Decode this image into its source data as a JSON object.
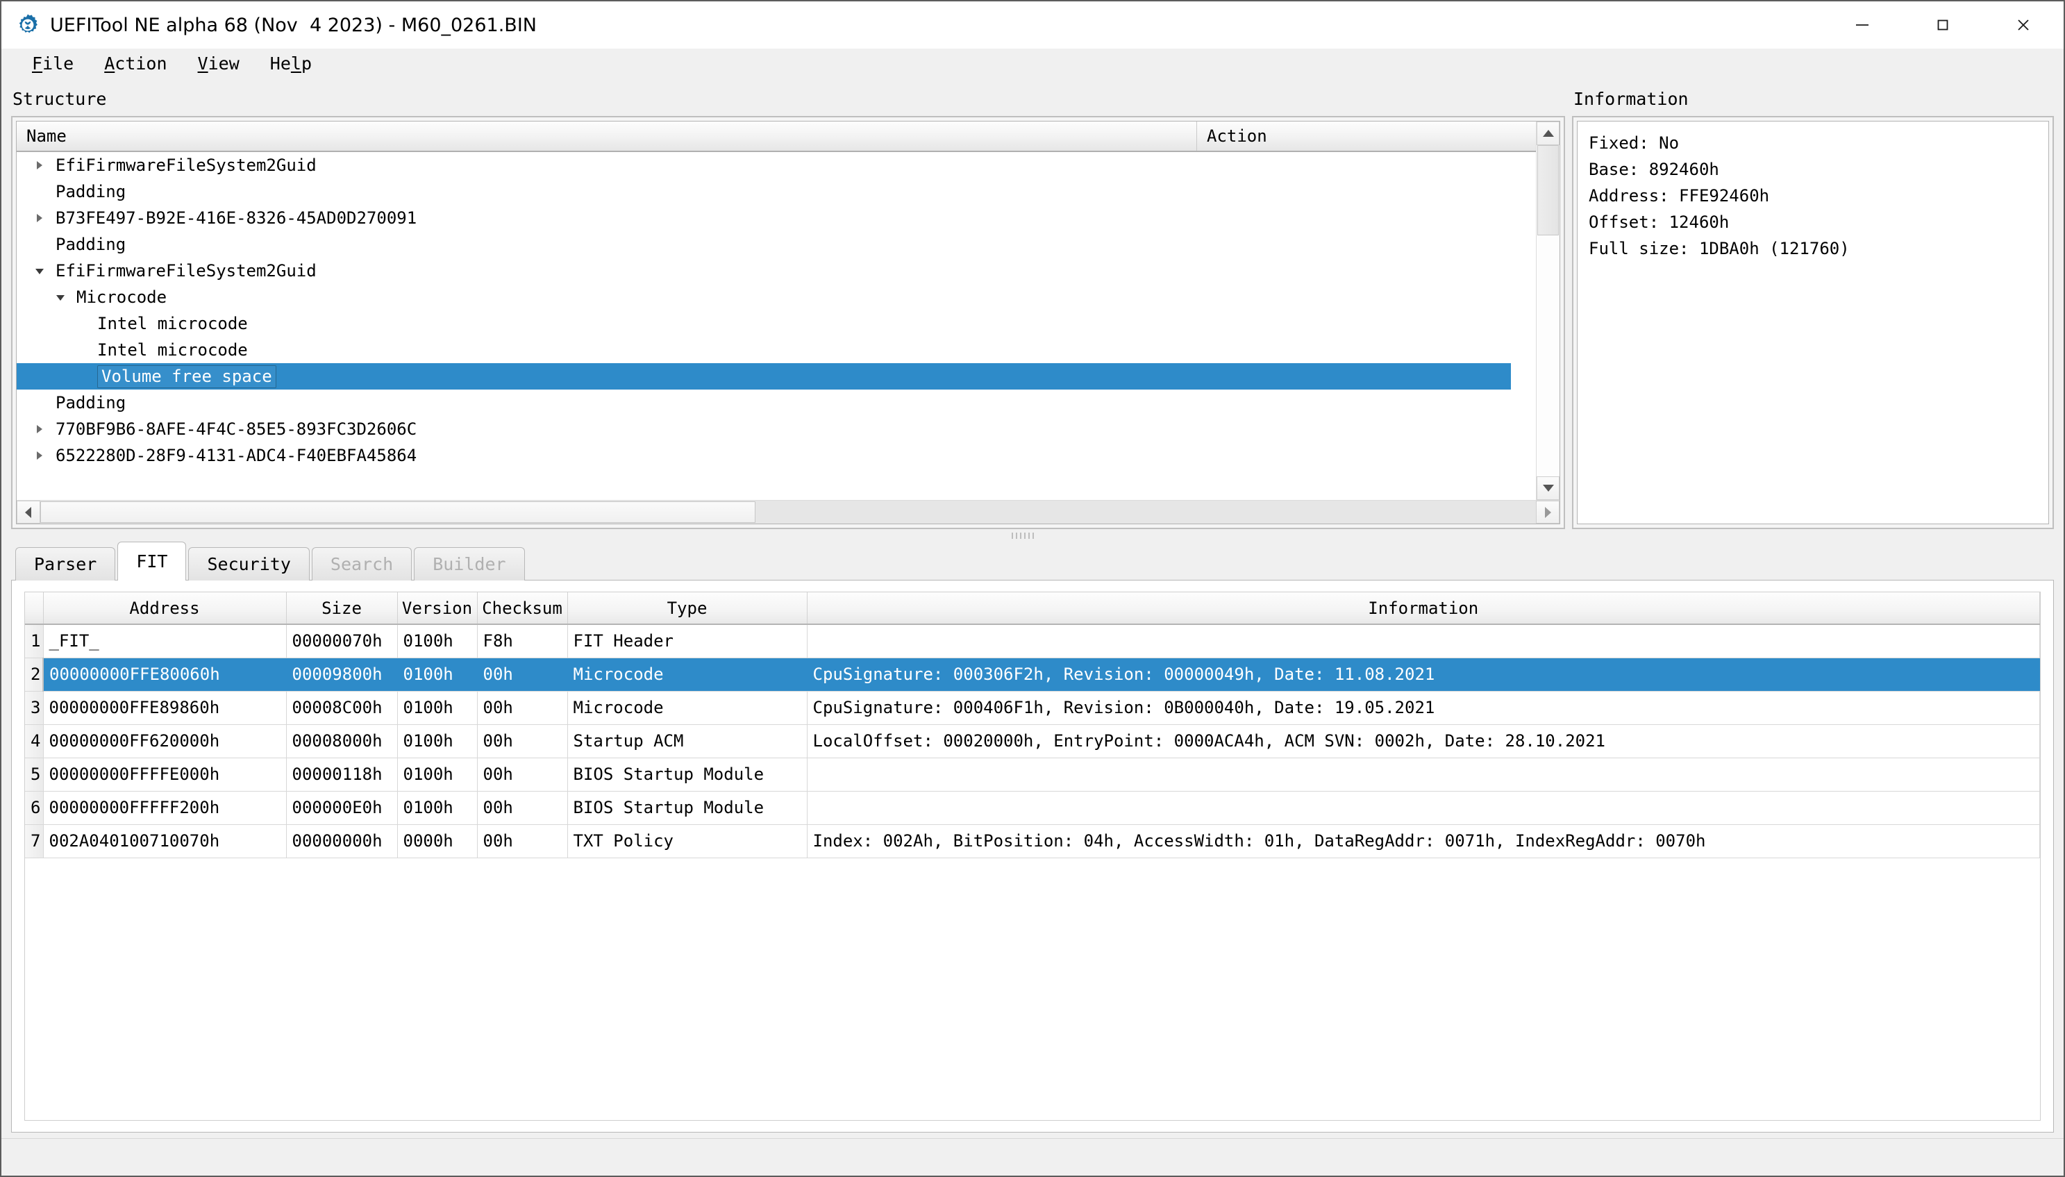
{
  "window": {
    "title": "UEFITool NE alpha 68 (Nov  4 2023) - M60_0261.BIN",
    "icon": "uefitool-gear-icon",
    "minimize_label": "—",
    "maximize_label": "□",
    "close_label": "✕",
    "accent_color": "#2e8bc9"
  },
  "menubar": {
    "items": [
      {
        "label": "File",
        "mnemonic": "F"
      },
      {
        "label": "Action",
        "mnemonic": "A"
      },
      {
        "label": "View",
        "mnemonic": "V"
      },
      {
        "label": "Help",
        "mnemonic": "l"
      }
    ]
  },
  "structure": {
    "label": "Structure",
    "columns": [
      "Name",
      "Action"
    ],
    "rows": [
      {
        "name": "EfiFirmwareFileSystem2Guid",
        "indent": 1,
        "arrow": "collapsed",
        "selected": false
      },
      {
        "name": "Padding",
        "indent": 1,
        "arrow": "none",
        "selected": false
      },
      {
        "name": "B73FE497-B92E-416E-8326-45AD0D270091",
        "indent": 1,
        "arrow": "collapsed",
        "selected": false
      },
      {
        "name": "Padding",
        "indent": 1,
        "arrow": "none",
        "selected": false
      },
      {
        "name": "EfiFirmwareFileSystem2Guid",
        "indent": 1,
        "arrow": "expanded",
        "selected": false
      },
      {
        "name": "Microcode",
        "indent": 2,
        "arrow": "expanded",
        "selected": false
      },
      {
        "name": "Intel microcode",
        "indent": 3,
        "arrow": "none",
        "selected": false
      },
      {
        "name": "Intel microcode",
        "indent": 3,
        "arrow": "none",
        "selected": false
      },
      {
        "name": "Volume free space",
        "indent": 3,
        "arrow": "none",
        "selected": true
      },
      {
        "name": "Padding",
        "indent": 1,
        "arrow": "none",
        "selected": false
      },
      {
        "name": "770BF9B6-8AFE-4F4C-85E5-893FC3D2606C",
        "indent": 1,
        "arrow": "collapsed",
        "selected": false
      },
      {
        "name": "6522280D-28F9-4131-ADC4-F40EBFA45864",
        "indent": 1,
        "arrow": "collapsed",
        "selected": false
      }
    ]
  },
  "information": {
    "label": "Information",
    "lines": [
      "Fixed: No",
      "Base: 892460h",
      "Address: FFE92460h",
      "Offset: 12460h",
      "Full size: 1DBA0h (121760)"
    ]
  },
  "tabs": [
    {
      "label": "Parser",
      "active": false,
      "disabled": false
    },
    {
      "label": "FIT",
      "active": true,
      "disabled": false
    },
    {
      "label": "Security",
      "active": false,
      "disabled": false
    },
    {
      "label": "Search",
      "active": false,
      "disabled": true
    },
    {
      "label": "Builder",
      "active": false,
      "disabled": true
    }
  ],
  "fit_table": {
    "columns": [
      "Address",
      "Size",
      "Version",
      "Checksum",
      "Type",
      "Information"
    ],
    "rows": [
      {
        "num": "1",
        "address": "_FIT_",
        "size": "00000070h",
        "version": "0100h",
        "checksum": "F8h",
        "type": "FIT Header",
        "information": "",
        "selected": false
      },
      {
        "num": "2",
        "address": "00000000FFE80060h",
        "size": "00009800h",
        "version": "0100h",
        "checksum": "00h",
        "type": "Microcode",
        "information": "CpuSignature: 000306F2h, Revision: 00000049h, Date: 11.08.2021",
        "selected": true
      },
      {
        "num": "3",
        "address": "00000000FFE89860h",
        "size": "00008C00h",
        "version": "0100h",
        "checksum": "00h",
        "type": "Microcode",
        "information": "CpuSignature: 000406F1h, Revision: 0B000040h, Date: 19.05.2021",
        "selected": false
      },
      {
        "num": "4",
        "address": "00000000FF620000h",
        "size": "00008000h",
        "version": "0100h",
        "checksum": "00h",
        "type": "Startup ACM",
        "information": "LocalOffset: 00020000h, EntryPoint: 0000ACA4h, ACM SVN: 0002h, Date: 28.10.2021",
        "selected": false
      },
      {
        "num": "5",
        "address": "00000000FFFFE000h",
        "size": "00000118h",
        "version": "0100h",
        "checksum": "00h",
        "type": "BIOS Startup Module",
        "information": "",
        "selected": false
      },
      {
        "num": "6",
        "address": "00000000FFFFF200h",
        "size": "000000E0h",
        "version": "0100h",
        "checksum": "00h",
        "type": "BIOS Startup Module",
        "information": "",
        "selected": false
      },
      {
        "num": "7",
        "address": "002A040100710070h",
        "size": "00000000h",
        "version": "0000h",
        "checksum": "00h",
        "type": "TXT Policy",
        "information": "Index: 002Ah, BitPosition: 04h, AccessWidth: 01h, DataRegAddr: 0071h, IndexRegAddr: 0070h",
        "selected": false
      }
    ]
  }
}
